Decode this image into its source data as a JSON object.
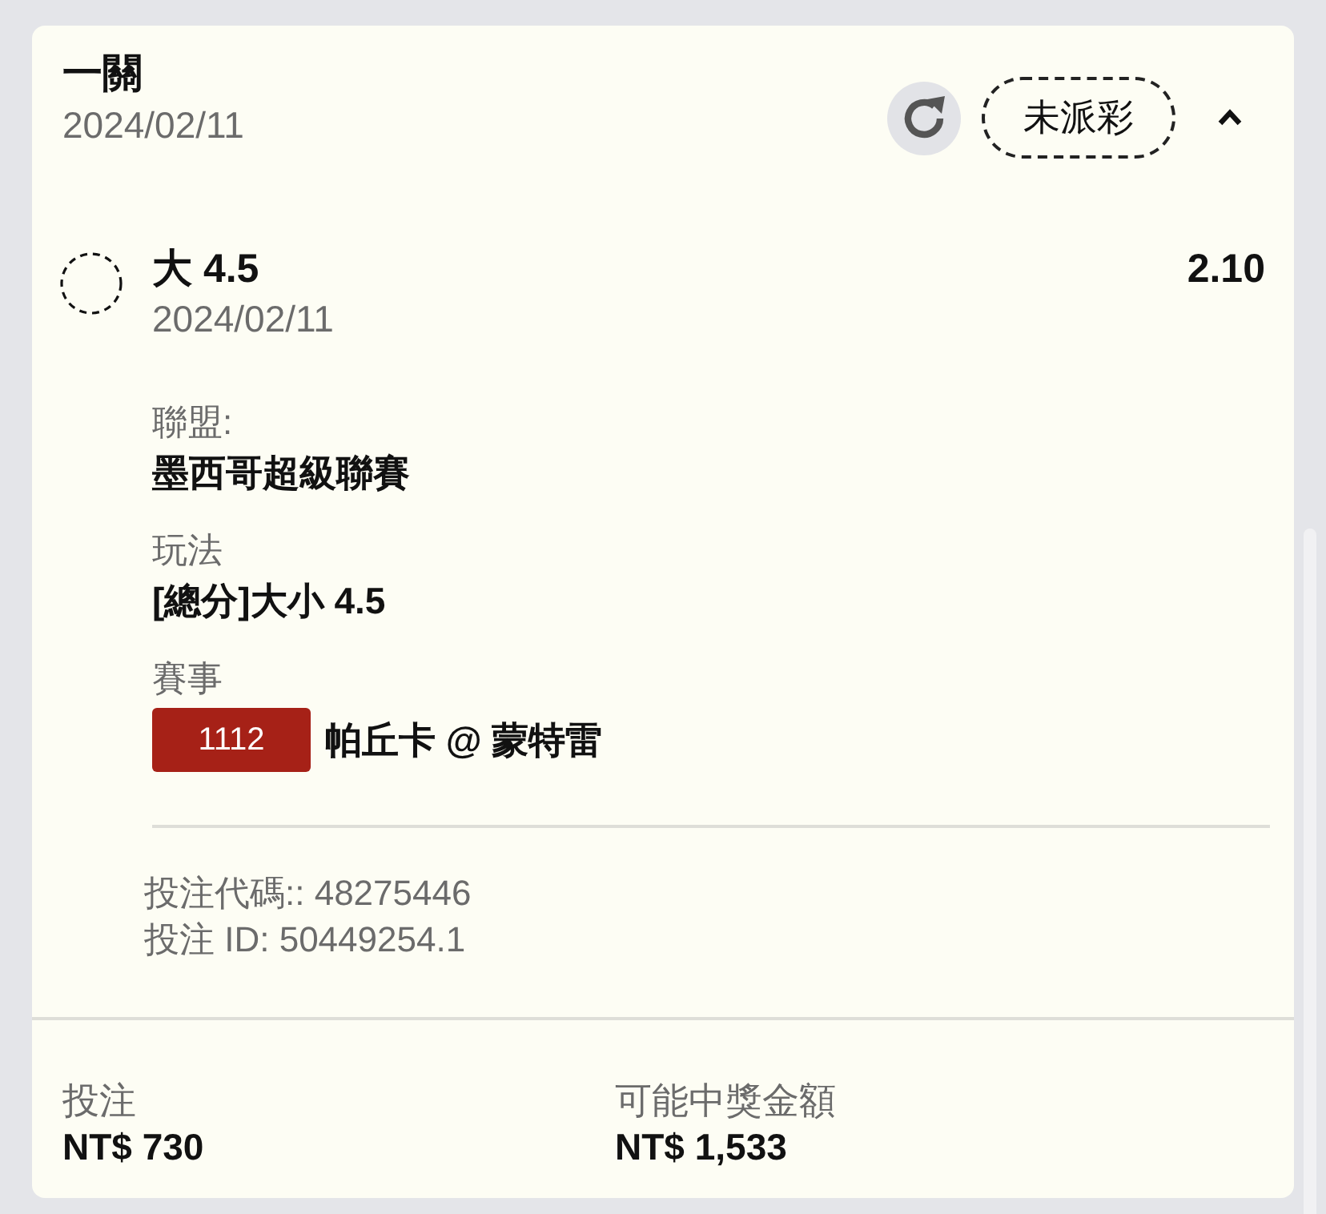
{
  "header": {
    "title": "一關",
    "date": "2024/02/11",
    "status": "未派彩",
    "expanded": true
  },
  "selection": {
    "name": "大 4.5",
    "date": "2024/02/11",
    "odds": "2.10"
  },
  "details": [
    {
      "label": "聯盟:",
      "value": "墨西哥超級聯賽"
    },
    {
      "label": "玩法",
      "value": "[總分]大小 4.5"
    },
    {
      "label": "賽事",
      "badge": "1112",
      "value": "帕丘卡 @ 蒙特雷"
    }
  ],
  "references": [
    "投注代碼:: 48275446",
    "投注 ID: 50449254.1"
  ],
  "summary": [
    {
      "label": "投注",
      "value": "NT$ 730"
    },
    {
      "label": "可能中獎金額",
      "value": "NT$ 1,533"
    }
  ]
}
